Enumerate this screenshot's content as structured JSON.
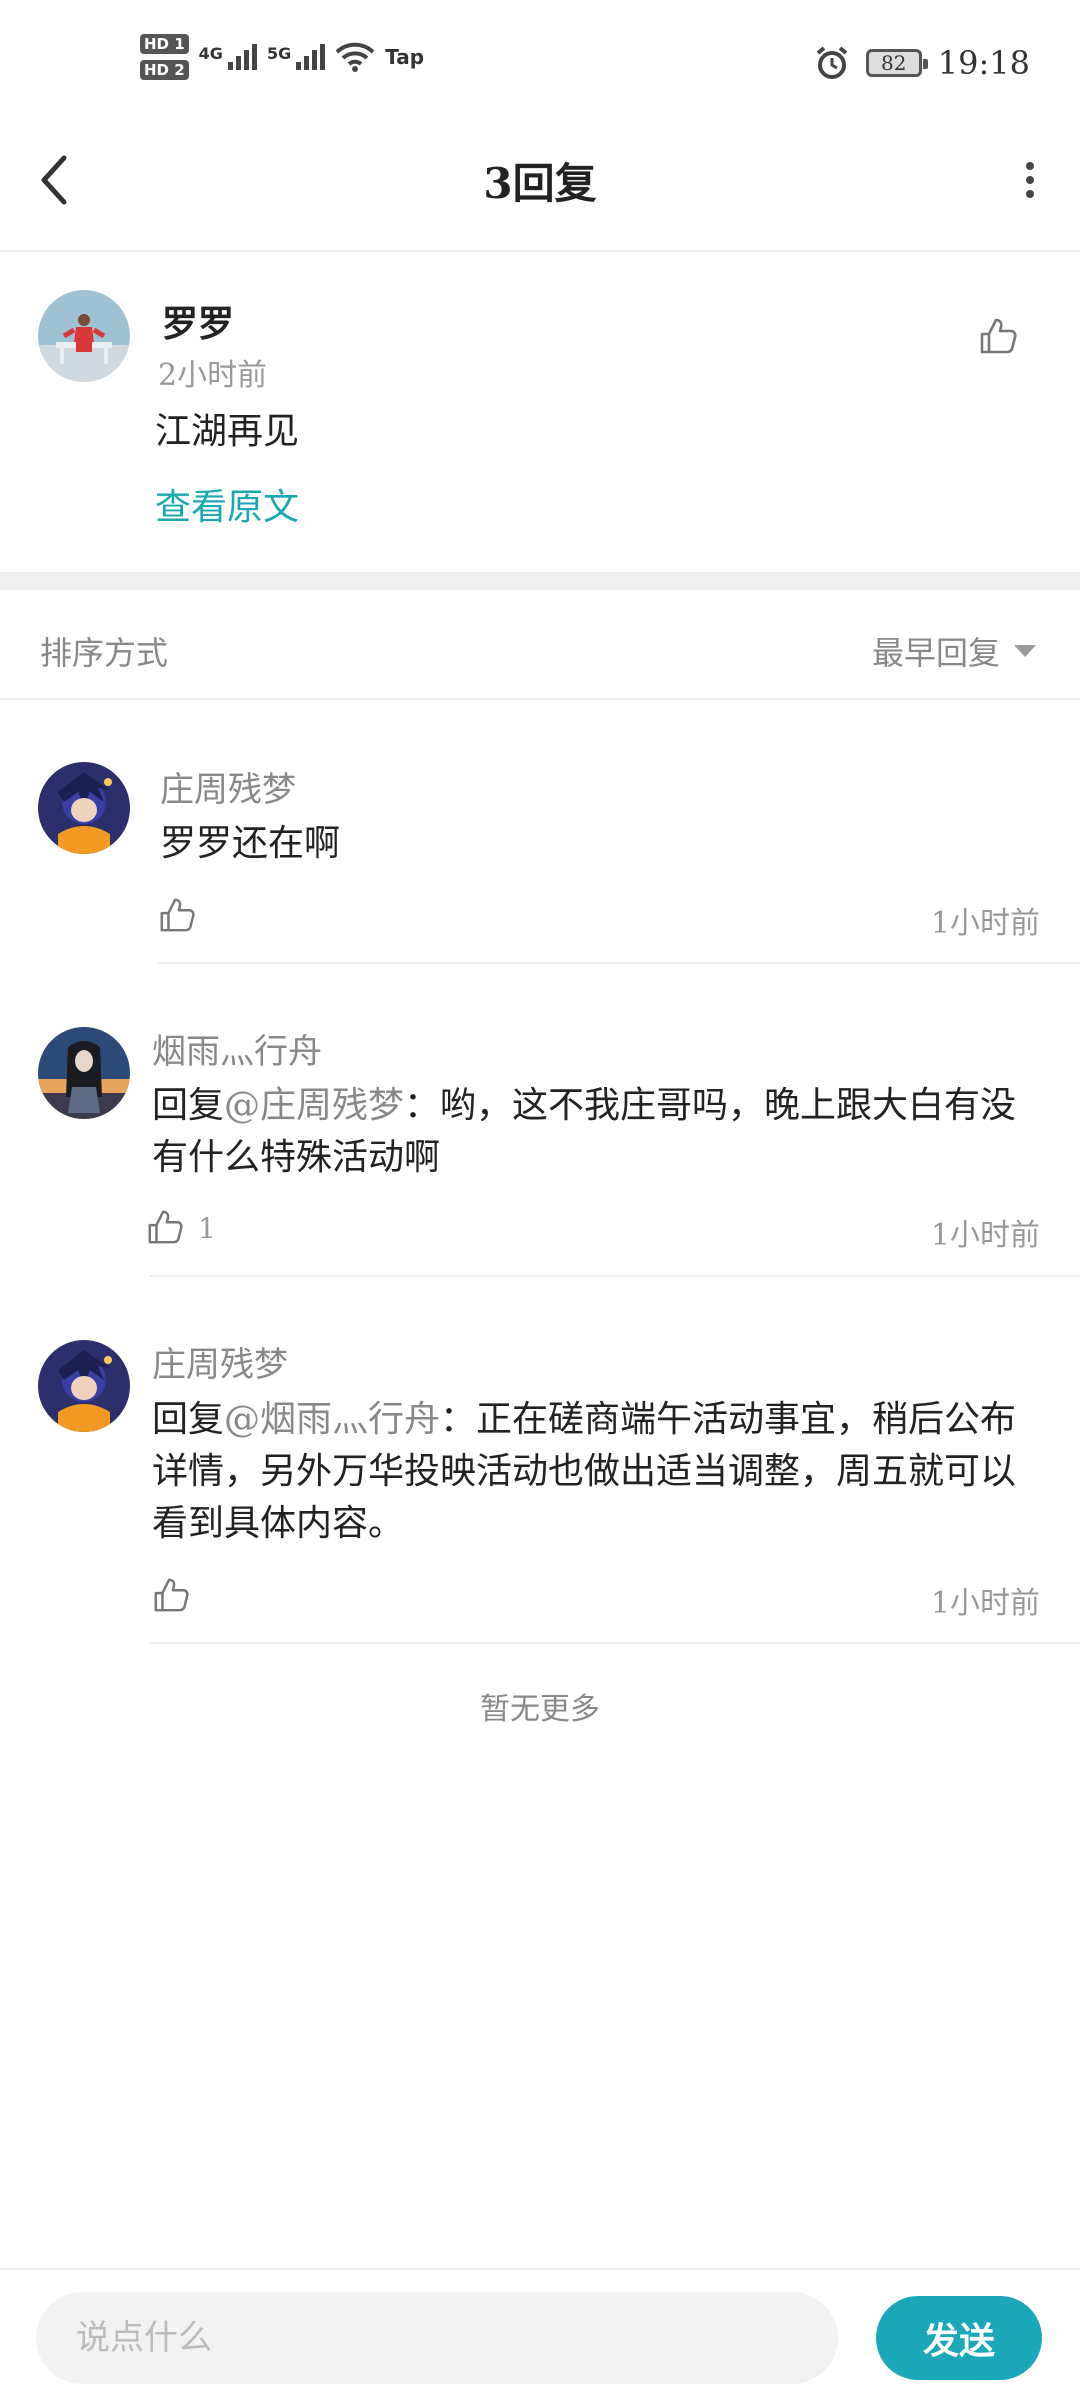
{
  "status_bar": {
    "hd1": "HD 1",
    "hd2": "HD 2",
    "net1": "4G",
    "net2": "5G",
    "tap": "Tap",
    "battery": "82",
    "time": "19:18"
  },
  "header": {
    "title": "3回复",
    "back_icon": "chevron-left-icon",
    "more_icon": "more-vertical-icon"
  },
  "post": {
    "author": "罗罗",
    "time": "2小时前",
    "content": "江湖再见",
    "view_original": "查看原文"
  },
  "sort": {
    "label": "排序方式",
    "value": "最早回复"
  },
  "replies": [
    {
      "author": "庄周残梦",
      "text_prefix": "",
      "mention": "",
      "text": "罗罗还在啊",
      "likes": "",
      "time": "1小时前"
    },
    {
      "author": "烟雨灬行舟",
      "text_prefix": "回复",
      "mention": "@庄周残梦",
      "text": "：哟，这不我庄哥吗，晚上跟大白有没有什么特殊活动啊",
      "likes": "1",
      "time": "1小时前"
    },
    {
      "author": "庄周残梦",
      "text_prefix": "回复",
      "mention": "@烟雨灬行舟",
      "text": "：正在磋商端午活动事宜，稍后公布详情，另外万华投映活动也做出适当调整，周五就可以看到具体内容。",
      "likes": "",
      "time": "1小时前"
    }
  ],
  "footer": {
    "no_more": "暂无更多",
    "input_placeholder": "说点什么",
    "send": "发送"
  },
  "colors": {
    "accent": "#1aa8b8",
    "link": "#1aa8b0"
  }
}
